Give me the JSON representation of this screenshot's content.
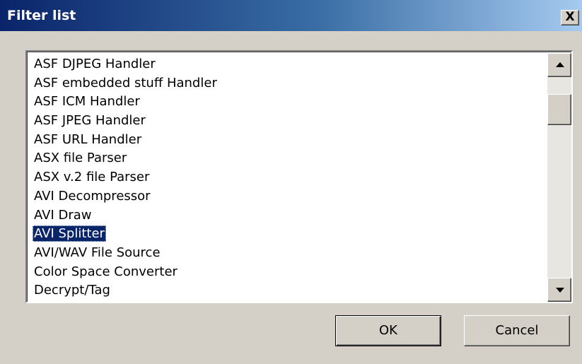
{
  "window": {
    "title": "Filter list",
    "close_glyph": "X"
  },
  "list": {
    "items": [
      {
        "label": "ASF DJPEG Handler",
        "selected": false
      },
      {
        "label": "ASF embedded stuff Handler",
        "selected": false
      },
      {
        "label": "ASF ICM Handler",
        "selected": false
      },
      {
        "label": "ASF JPEG Handler",
        "selected": false
      },
      {
        "label": "ASF URL Handler",
        "selected": false
      },
      {
        "label": "ASX file Parser",
        "selected": false
      },
      {
        "label": "ASX v.2 file Parser",
        "selected": false
      },
      {
        "label": "AVI Decompressor",
        "selected": false
      },
      {
        "label": "AVI Draw",
        "selected": false
      },
      {
        "label": "AVI Splitter",
        "selected": true
      },
      {
        "label": "AVI/WAV File Source",
        "selected": false
      },
      {
        "label": "Color Space Converter",
        "selected": false
      },
      {
        "label": "Decrypt/Tag",
        "selected": false
      }
    ],
    "selected_label": "AVI Splitter"
  },
  "scrollbar": {
    "up_icon": "arrow-up-icon",
    "down_icon": "arrow-down-icon"
  },
  "buttons": {
    "ok_label": "OK",
    "cancel_label": "Cancel"
  },
  "colors": {
    "title_gradient_start": "#0a246a",
    "title_gradient_end": "#a6caf0",
    "selection": "#0a246a",
    "face": "#d4d0c8"
  }
}
